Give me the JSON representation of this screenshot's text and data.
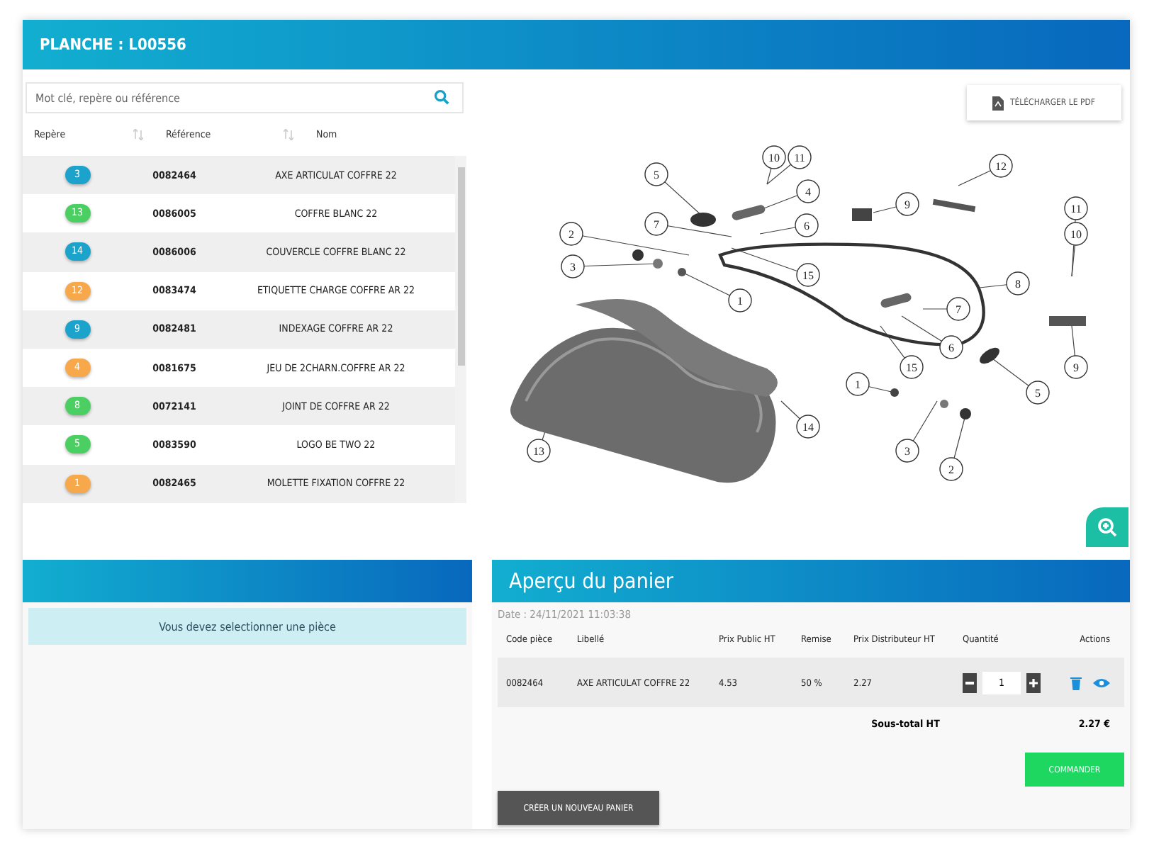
{
  "header": {
    "title": "PLANCHE : L00556"
  },
  "search": {
    "placeholder": "Mot clé, repère ou référence"
  },
  "parts_table": {
    "columns": [
      {
        "label": "Repère",
        "sortable": true
      },
      {
        "label": "Référence",
        "sortable": true
      },
      {
        "label": "Nom",
        "sortable": false
      }
    ],
    "rows": [
      {
        "repere": "3",
        "color": "#1ba3cc",
        "reference": "0082464",
        "nom": "AXE ARTICULAT COFFRE 22"
      },
      {
        "repere": "13",
        "color": "#4ccf62",
        "reference": "0086005",
        "nom": "COFFRE BLANC 22"
      },
      {
        "repere": "14",
        "color": "#1ba3cc",
        "reference": "0086006",
        "nom": "COUVERCLE COFFRE BLANC 22"
      },
      {
        "repere": "12",
        "color": "#f6a84a",
        "reference": "0083474",
        "nom": "ETIQUETTE CHARGE COFFRE AR 22"
      },
      {
        "repere": "9",
        "color": "#1ba3cc",
        "reference": "0082481",
        "nom": "INDEXAGE COFFRE AR 22"
      },
      {
        "repere": "4",
        "color": "#f6a84a",
        "reference": "0081675",
        "nom": "JEU DE 2CHARN.COFFRE AR 22"
      },
      {
        "repere": "8",
        "color": "#4ccf62",
        "reference": "0072141",
        "nom": "JOINT DE COFFRE AR 22"
      },
      {
        "repere": "5",
        "color": "#4ccf62",
        "reference": "0083590",
        "nom": "LOGO BE TWO 22"
      },
      {
        "repere": "1",
        "color": "#f6a84a",
        "reference": "0082465",
        "nom": "MOLETTE FIXATION COFFRE 22"
      }
    ]
  },
  "diagram": {
    "download_button": "TÉLÉCHARGER LE PDF",
    "callouts": [
      "10",
      "11",
      "12",
      "5",
      "4",
      "9",
      "11",
      "7",
      "6",
      "2",
      "10",
      "3",
      "15",
      "8",
      "1",
      "7",
      "6",
      "15",
      "9",
      "1",
      "5",
      "14",
      "13",
      "3",
      "2"
    ]
  },
  "detail_panel": {
    "alert": "Vous devez selectionner une pièce"
  },
  "cart": {
    "title": "Aperçu du panier",
    "date": "Date : 24/11/2021 11:03:38",
    "columns": [
      "Code pièce",
      "Libellé",
      "Prix Public HT",
      "Remise",
      "Prix Distributeur HT",
      "Quantité",
      "Actions"
    ],
    "rows": [
      {
        "code": "0082464",
        "libelle": "AXE ARTICULAT COFFRE 22",
        "prix_public": "4.53",
        "remise": "50 %",
        "prix_distributeur": "2.27",
        "quantite": "1"
      }
    ],
    "subtotal_label": "Sous-total HT",
    "subtotal": "2.27 €",
    "order_button": "COMMANDER",
    "new_cart_button": "CRÉER UN NOUVEAU PANIER"
  }
}
